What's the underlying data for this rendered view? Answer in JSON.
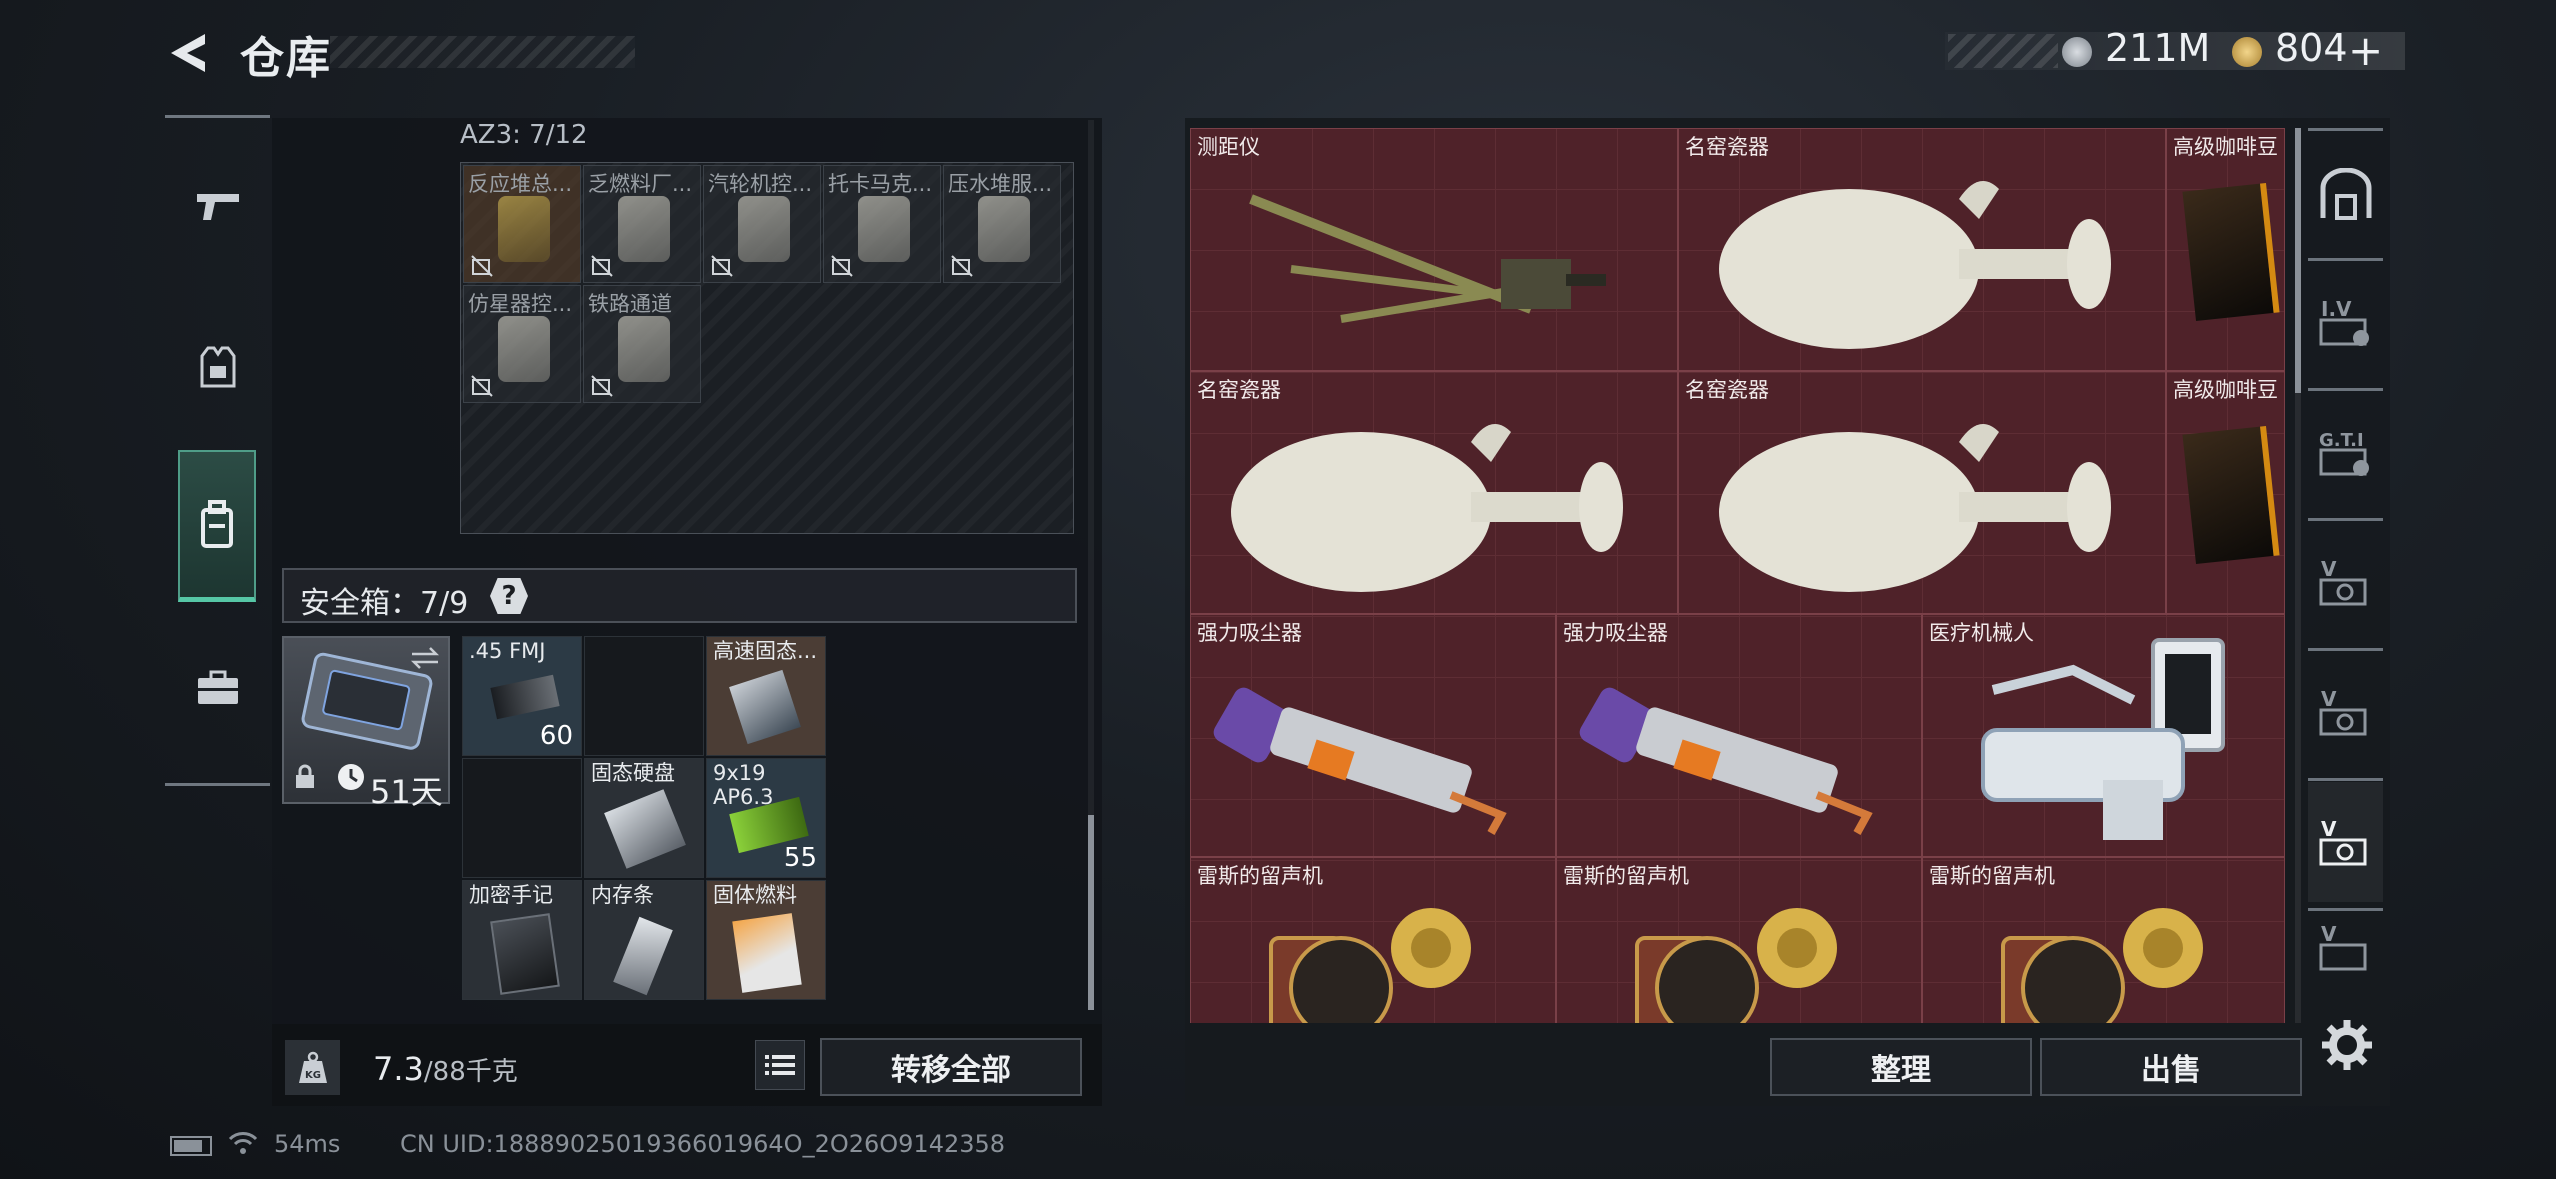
{
  "header": {
    "title": "仓库",
    "silver_value": "211M",
    "gold_value": "804",
    "gold_plus": "+"
  },
  "left_rail": [
    "firearms-tab",
    "gear-tab",
    "backpack-tab",
    "toolbox-tab"
  ],
  "container": {
    "label": "AZ3: 7/12",
    "items": [
      {
        "label": "反应堆总..."
      },
      {
        "label": "乏燃料厂..."
      },
      {
        "label": "汽轮机控..."
      },
      {
        "label": "托卡马克..."
      },
      {
        "label": "压水堆服..."
      },
      {
        "label": "仿星器控..."
      },
      {
        "label": "铁路通道"
      }
    ]
  },
  "safe_box": {
    "label": "安全箱：7/9",
    "help": "?",
    "days": "51天",
    "slots": [
      {
        "label": ".45 FMJ",
        "count": "60"
      },
      {
        "label": "",
        "count": ""
      },
      {
        "label": "高速固态...",
        "count": ""
      },
      {
        "label": "",
        "count": ""
      },
      {
        "label": "固态硬盘",
        "count": ""
      },
      {
        "label": "9x19 AP6.3",
        "count": "55"
      },
      {
        "label": "加密手记",
        "count": ""
      },
      {
        "label": "内存条",
        "count": ""
      },
      {
        "label": "固体燃料",
        "count": ""
      }
    ]
  },
  "weight": {
    "current": "7.3",
    "max": "/88千克"
  },
  "transfer_all": "转移全部",
  "stash_items": [
    {
      "label": "测距仪"
    },
    {
      "label": "名窑瓷器"
    },
    {
      "label": "高级咖啡豆"
    },
    {
      "label": "名窑瓷器"
    },
    {
      "label": "名窑瓷器"
    },
    {
      "label": "高级咖啡豆"
    },
    {
      "label": "强力吸尘器"
    },
    {
      "label": "强力吸尘器"
    },
    {
      "label": "医疗机械人"
    },
    {
      "label": "雷斯的留声机"
    },
    {
      "label": "雷斯的留声机"
    },
    {
      "label": "雷斯的留声机"
    }
  ],
  "actions": {
    "organize": "整理",
    "sell": "出售"
  },
  "status": {
    "ping": "54ms",
    "uid": "CN UID:1888902501936601964O_2O26O9142358"
  },
  "colors": {
    "accent_green": "#56c7a6",
    "stash_bg": "#4a2329"
  }
}
